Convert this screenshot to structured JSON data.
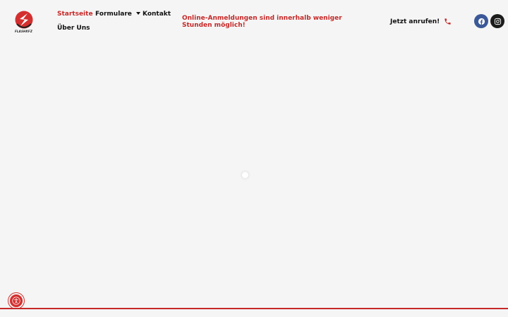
{
  "header": {
    "logo": {
      "text": "FLASHKFZ"
    },
    "nav": {
      "startseite": "Startseite",
      "formulare": "Formulare",
      "kontakt": "Kontakt",
      "ueber_uns": "Über Uns"
    },
    "notice": "Online-Anmeldungen sind innerhalb weniger Stunden möglich!",
    "call": {
      "label": "Jetzt anrufen!",
      "icon": "phone-icon"
    },
    "social": [
      {
        "name": "facebook",
        "icon": "facebook-icon"
      },
      {
        "name": "instagram",
        "icon": "instagram-icon"
      }
    ]
  },
  "accessibility": {
    "icon": "accessibility-icon"
  },
  "colors": {
    "accent": "#c62828",
    "background": "#f5f5f5",
    "facebook": "#3b5998",
    "instagram": "#1c1c1c"
  }
}
